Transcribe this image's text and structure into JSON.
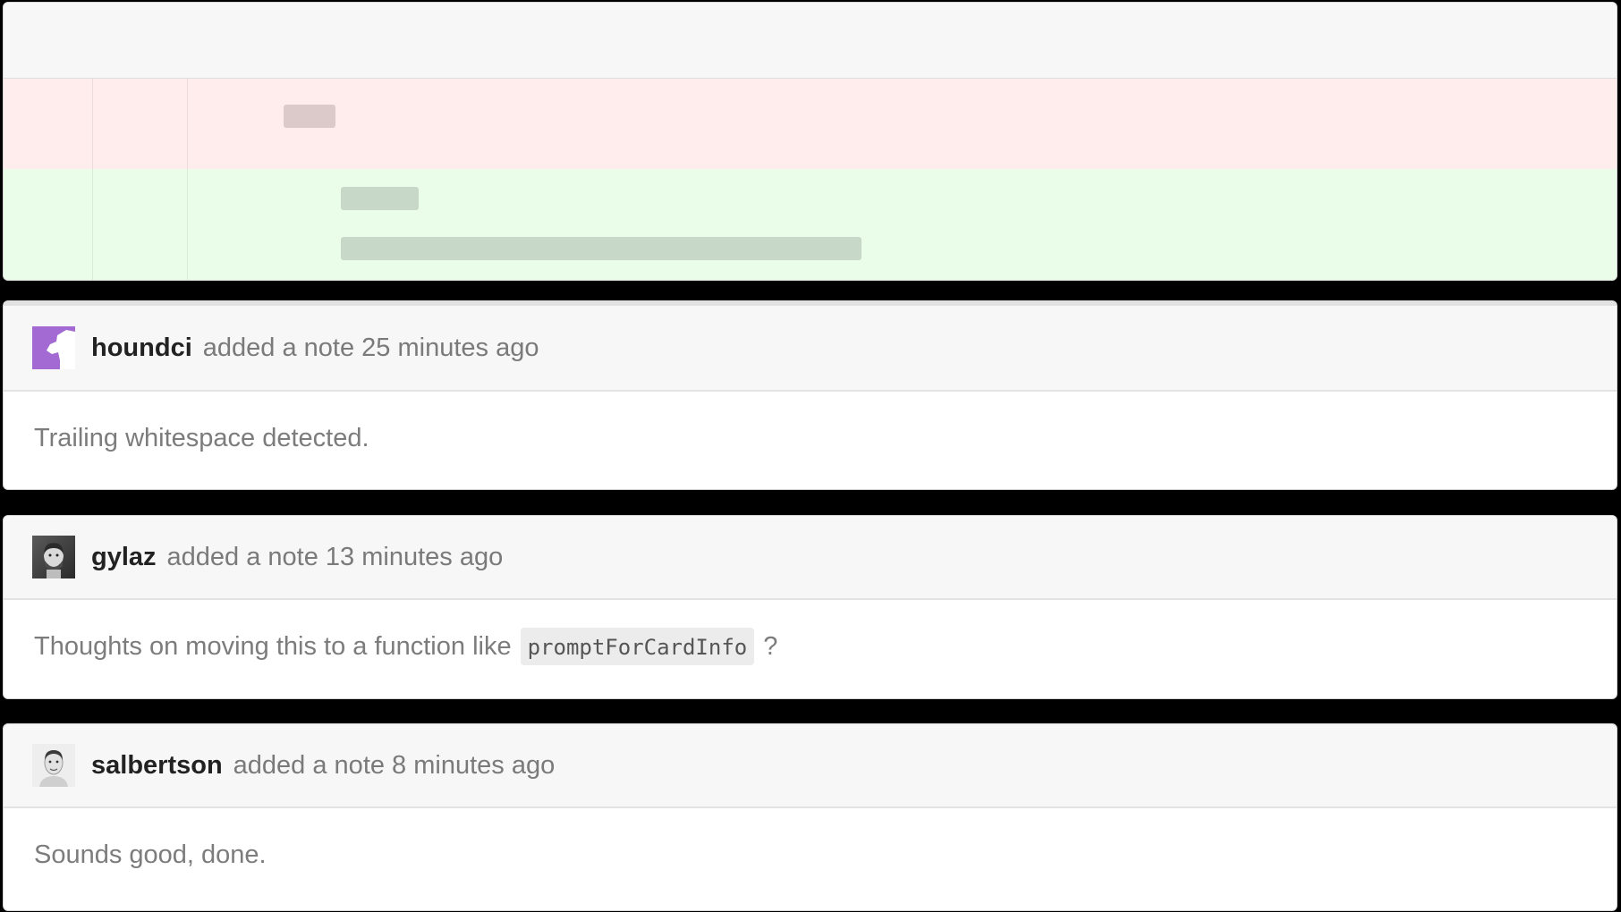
{
  "comments": [
    {
      "author": "houndci",
      "meta": "added a note 25 minutes ago",
      "body": "Trailing whitespace detected.",
      "avatar_color": "#a26ad2",
      "avatar_icon": "dog-head-logo-icon"
    },
    {
      "author": "gylaz",
      "meta": "added a note 13 minutes ago",
      "body_before": "Thoughts on moving this to a function like",
      "body_code": "promptForCardInfo",
      "body_after": "?",
      "avatar_icon": "user-photo"
    },
    {
      "author": "salbertson",
      "meta": "added a note 8 minutes ago",
      "body": "Sounds good, done.",
      "avatar_icon": "user-photo"
    }
  ],
  "colors": {
    "removed_bg": "#ffecec",
    "added_bg": "#e9fde9"
  }
}
